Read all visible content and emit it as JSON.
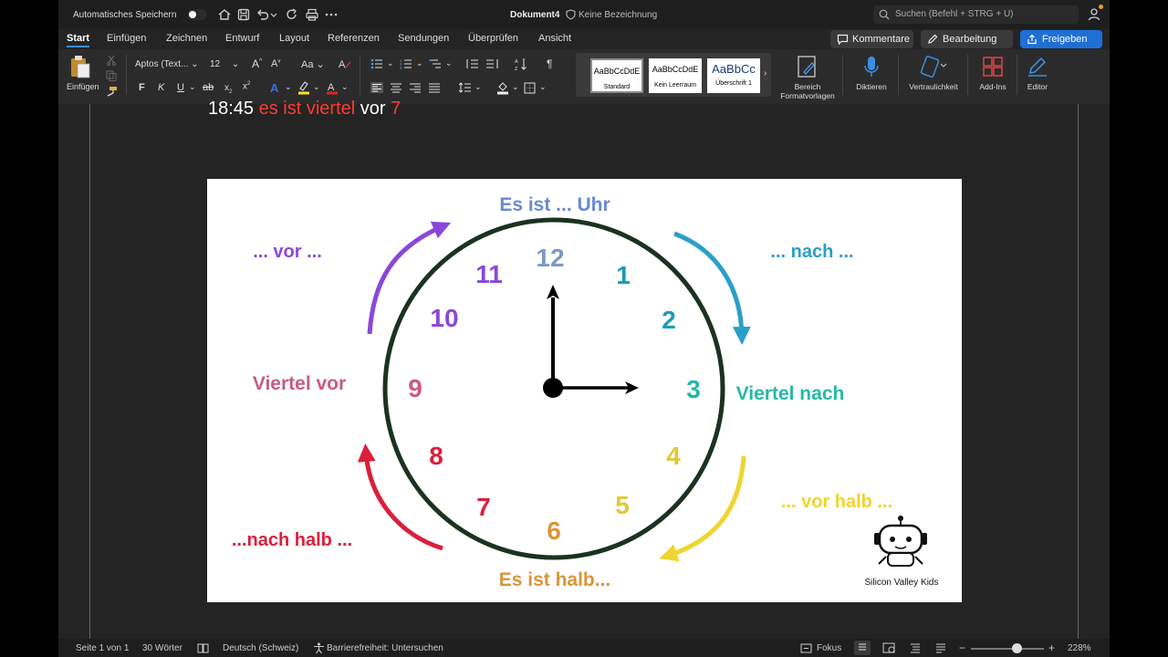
{
  "titlebar": {
    "autosave_label": "Automatisches Speichern",
    "doc_title": "Dokument4",
    "doc_label": "Keine Bezeichnung",
    "search_placeholder": "Suchen (Befehl + STRG + U)"
  },
  "tabs": [
    "Start",
    "Einfügen",
    "Zeichnen",
    "Entwurf",
    "Layout",
    "Referenzen",
    "Sendungen",
    "Überprüfen",
    "Ansicht"
  ],
  "actions": {
    "comments": "Kommentare",
    "editing": "Bearbeitung",
    "share": "Freigeben"
  },
  "ribbon": {
    "paste_label": "Einfügen",
    "font_name": "Aptos (Text...",
    "font_size": "12",
    "bold": "F",
    "italic": "K",
    "underline": "U",
    "styles": [
      {
        "sample": "AaBbCcDdE",
        "name": "Standard"
      },
      {
        "sample": "AaBbCcDdE",
        "name": "Kein Leerraum"
      },
      {
        "sample": "AaBbCc",
        "name": "Überschrift 1"
      }
    ],
    "bereich_line1": "Bereich",
    "bereich_line2": "Formatvorlagen",
    "diktieren": "Diktieren",
    "vertraulichkeit": "Vertraulichkeit",
    "addins": "Add-Ins",
    "editor": "Editor"
  },
  "document": {
    "time": "18:45",
    "red_phrase": "es ist viertel",
    "vor": "vor",
    "seven": "7"
  },
  "clock_image": {
    "top_label": "Es ist ... Uhr",
    "bottom_label": "Es ist halb...",
    "vor": "... vor ...",
    "nach": "... nach ...",
    "viertel_vor": "Viertel vor",
    "viertel_nach": "Viertel nach",
    "vor_halb": "... vor halb ...",
    "nach_halb": "...nach halb ...",
    "brand": "Silicon Valley Kids",
    "numbers": [
      "12",
      "1",
      "2",
      "3",
      "4",
      "5",
      "6",
      "7",
      "8",
      "9",
      "10",
      "11"
    ],
    "colors": {
      "purple": "#8a48d8",
      "blue": "#2aa0c8",
      "teal": "#26b8a8",
      "yellow": "#f0d430",
      "orange": "#d9953a",
      "red": "#d9203c",
      "pink": "#c95a86",
      "top_label": "#6a8ad0"
    }
  },
  "status": {
    "page": "Seite 1 von 1",
    "words": "30 Wörter",
    "language": "Deutsch (Schweiz)",
    "accessibility": "Barrierefreiheit: Untersuchen",
    "focus": "Fokus",
    "zoom": "228%"
  }
}
